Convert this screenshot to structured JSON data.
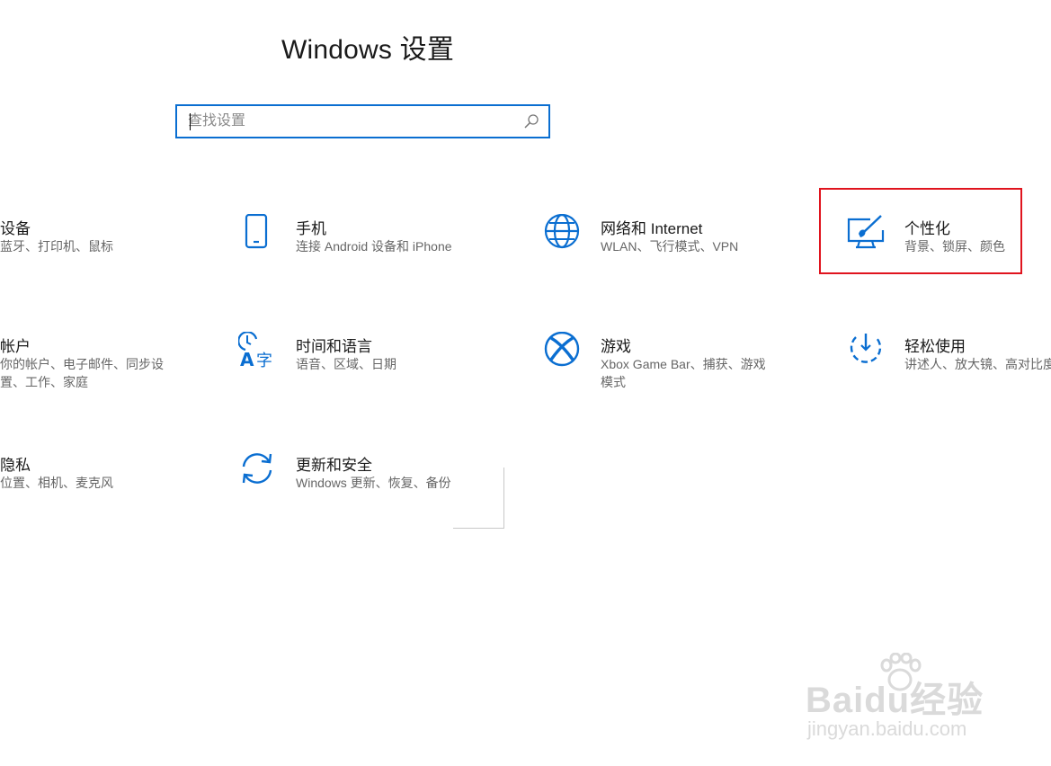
{
  "page": {
    "title": "Windows 设置"
  },
  "search": {
    "placeholder": "查找设置"
  },
  "tiles": [
    {
      "icon": "devices-icon",
      "label": "设备",
      "desc": "蓝牙、打印机、鼠标"
    },
    {
      "icon": "phone-icon",
      "label": "手机",
      "desc": "连接 Android 设备和 iPhone"
    },
    {
      "icon": "globe-icon",
      "label": "网络和 Internet",
      "desc": "WLAN、飞行模式、VPN"
    },
    {
      "icon": "personalization-icon",
      "label": "个性化",
      "desc": "背景、锁屏、颜色"
    },
    {
      "icon": "accounts-icon",
      "label": "帐户",
      "desc": "你的帐户、电子邮件、同步设",
      "desc2": "置、工作、家庭"
    },
    {
      "icon": "time-language-icon",
      "label": "时间和语言",
      "desc": "语音、区域、日期"
    },
    {
      "icon": "xbox-icon",
      "label": "游戏",
      "desc": "Xbox Game Bar、捕获、游戏",
      "desc2": "模式"
    },
    {
      "icon": "ease-of-access-icon",
      "label": "轻松使用",
      "desc": "讲述人、放大镜、高对比度"
    },
    {
      "icon": "privacy-icon",
      "label": "隐私",
      "desc": "位置、相机、麦克风"
    },
    {
      "icon": "update-icon",
      "label": "更新和安全",
      "desc": "Windows 更新、恢复、备份"
    }
  ],
  "watermark": {
    "brand": "Baidu经验",
    "url": "jingyan.baidu.com"
  },
  "colors": {
    "accent": "#0a6ed1",
    "highlight": "#e0141e"
  }
}
